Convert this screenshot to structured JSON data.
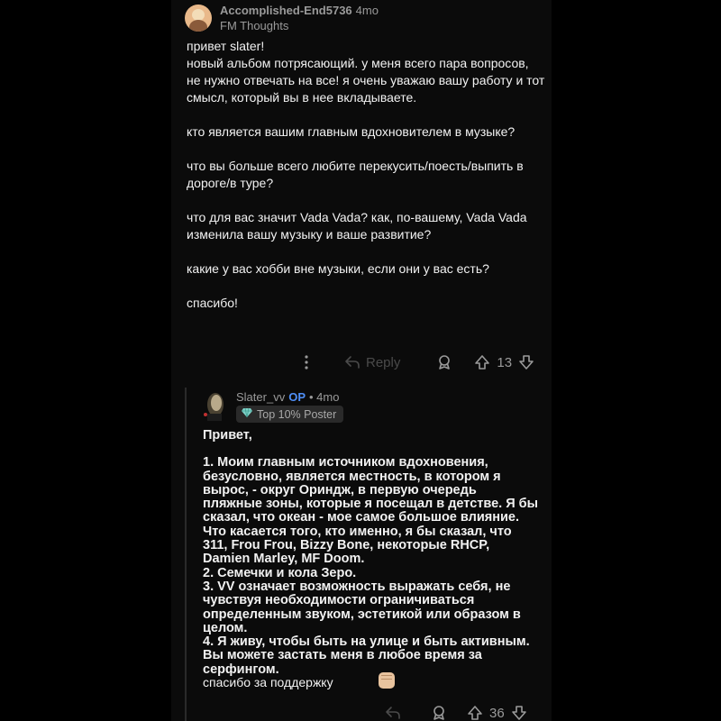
{
  "comment1": {
    "username": "Accomplished-End5736",
    "age": "4mo",
    "flair": "FM Thoughts",
    "paragraphs": [
      "привет slater!\nновый альбом потрясающий. у меня всего пара вопросов, не нужно отвечать на все! я очень уважаю вашу работу и тот смысл, который вы в нее вкладываете.",
      "кто является вашим главным вдохновителем в музыке?",
      "что вы больше всего любите перекусить/поесть/выпить в дороге/в туре?",
      "что для вас значит Vada Vada? как, по-вашему, Vada Vada изменила вашу музыку и ваше развитие?",
      "какие у вас хобби вне музыки, если они у вас есть?",
      "спасибо!"
    ],
    "reply_label": "Reply",
    "vote_count": "13"
  },
  "comment2": {
    "username": "Slater_vv",
    "op_label": "OP",
    "age": "• 4mo",
    "badge": "Top 10% Poster",
    "greeting": "Привет,",
    "paragraphs": [
      "1. Моим главным источником вдохновения, безусловно, является местность, в котором я вырос, - округ Ориндж, в первую очередь пляжные зоны, которые я посещал в детстве. Я бы сказал, что океан - мое самое большое влияние. Что касается того, кто именно, я бы сказал, что 311, Frou Frou, Bizzy Bone, некоторые RHCP, Damien Marley, MF Doom.\n2. Семечки и кола Зеро.\n3. VV означает возможность выражать себя, не чувствуя необходимости ограничиваться определенным звуком, эстетикой или образом в целом.\n4. Я живу, чтобы быть на улице и быть активным. Вы можете застать меня в любое время за серфингом."
    ],
    "thanks": "спасибо за поддержку",
    "vote_count": "36"
  },
  "icons": {
    "more": "more-options-icon",
    "reply": "reply-arrow-icon",
    "award": "award-icon",
    "upvote": "upvote-arrow-icon",
    "downvote": "downvote-arrow-icon",
    "badge": "diamond-badge-icon",
    "emoji": "fist-bump-emoji"
  },
  "colors": {
    "background": "#0b0b0b",
    "op": "#4f8ff7",
    "muted": "#9a9a9a"
  }
}
